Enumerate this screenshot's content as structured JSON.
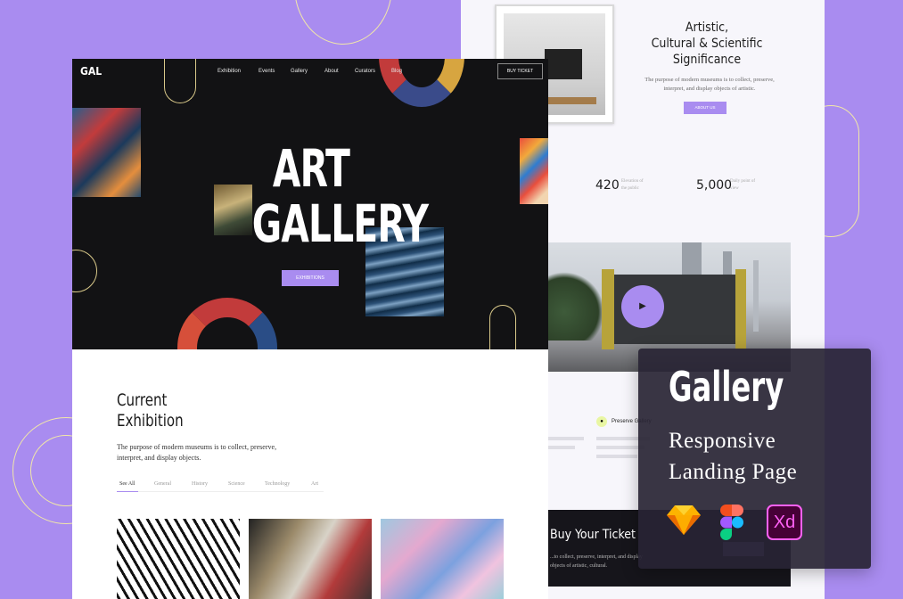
{
  "right_page": {
    "significance_title": "Artistic,\nCultural & Scientific\nSignificance",
    "significance_desc": "The purpose of modern museums is to collect, preserve, interpret, and display objects of artistic.",
    "about_button": "ABOUT US",
    "stats": [
      {
        "value": "420",
        "label": "Elevation of the public"
      },
      {
        "value": "5,000",
        "label": "Daily point of view"
      }
    ],
    "play_icon": "▶",
    "preserve_label": "Preserve Gallery",
    "ticket_title": "Buy Your Ticket",
    "ticket_desc": "...to collect, preserve, interpret, and display objects of artistic, cultural."
  },
  "hero": {
    "logo": "GAL",
    "nav": [
      "Exhibition",
      "Events",
      "Gallery",
      "About",
      "Curators",
      "Blog"
    ],
    "buy_ticket": "BUY TICKET",
    "title_line1": "ART",
    "title_line2": "GALLERY",
    "exhibitions_button": "EXHIBITIONS"
  },
  "current": {
    "title_line1": "Current",
    "title_line2": "Exhibition",
    "desc": "The purpose of modern museums is to collect, preserve, interpret, and display objects.",
    "filters": [
      "See All",
      "General",
      "History",
      "Science",
      "Technology",
      "Art"
    ]
  },
  "badge": {
    "title": "Gallery",
    "subtitle_line1": "Responsive",
    "subtitle_line2": "Landing Page",
    "xd_label": "Xd"
  },
  "colors": {
    "background": "#a98cf0",
    "accent": "#a98cf0",
    "hero_bg": "#121214",
    "badge_bg": "#282434"
  },
  "icons": [
    "play-icon",
    "sketch-icon",
    "figma-icon",
    "xd-icon",
    "gallery-mark-icon"
  ]
}
